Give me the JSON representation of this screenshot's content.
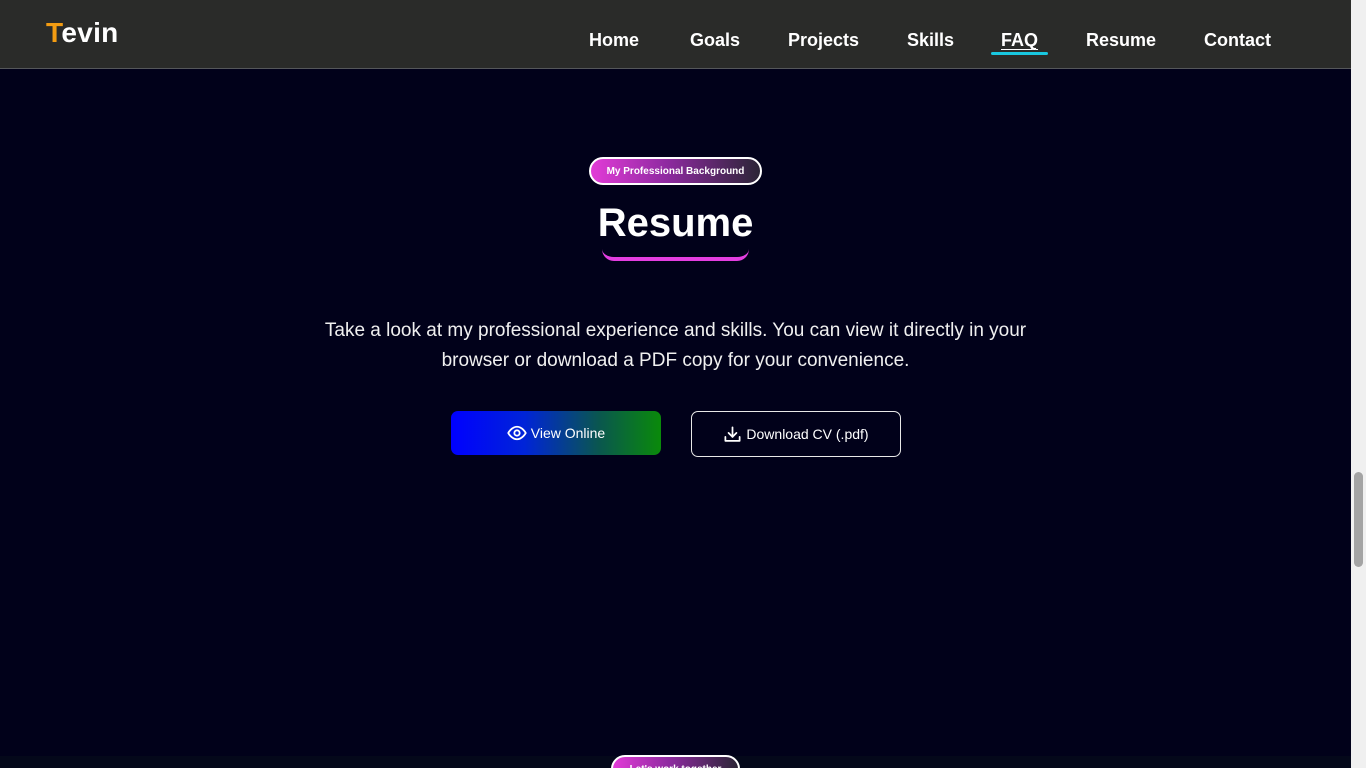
{
  "brand": {
    "first_letter": "T",
    "rest": "evin",
    "accent_color": "#f39c12"
  },
  "nav": {
    "items": [
      {
        "label": "Home"
      },
      {
        "label": "Goals"
      },
      {
        "label": "Projects"
      },
      {
        "label": "Skills"
      },
      {
        "label": "FAQ",
        "active": true
      },
      {
        "label": "Resume"
      },
      {
        "label": "Contact"
      }
    ],
    "active_indicator_color": "#19c8e0"
  },
  "section": {
    "badge": "My Professional Background",
    "title": "Resume",
    "description": "Take a look at my professional experience and skills. You can view it directly in your browser or download a PDF copy for your convenience.",
    "buttons": {
      "view_label": "View Online",
      "view_icon": "eye-icon",
      "download_label": "Download CV (.pdf)",
      "download_icon": "download-icon"
    }
  },
  "next_section": {
    "badge": "Let's work together"
  },
  "colors": {
    "background": "#01011a",
    "header": "#2a2b29",
    "badge_pink": "#e23bd7",
    "underline_pink": "#e33ee0"
  }
}
